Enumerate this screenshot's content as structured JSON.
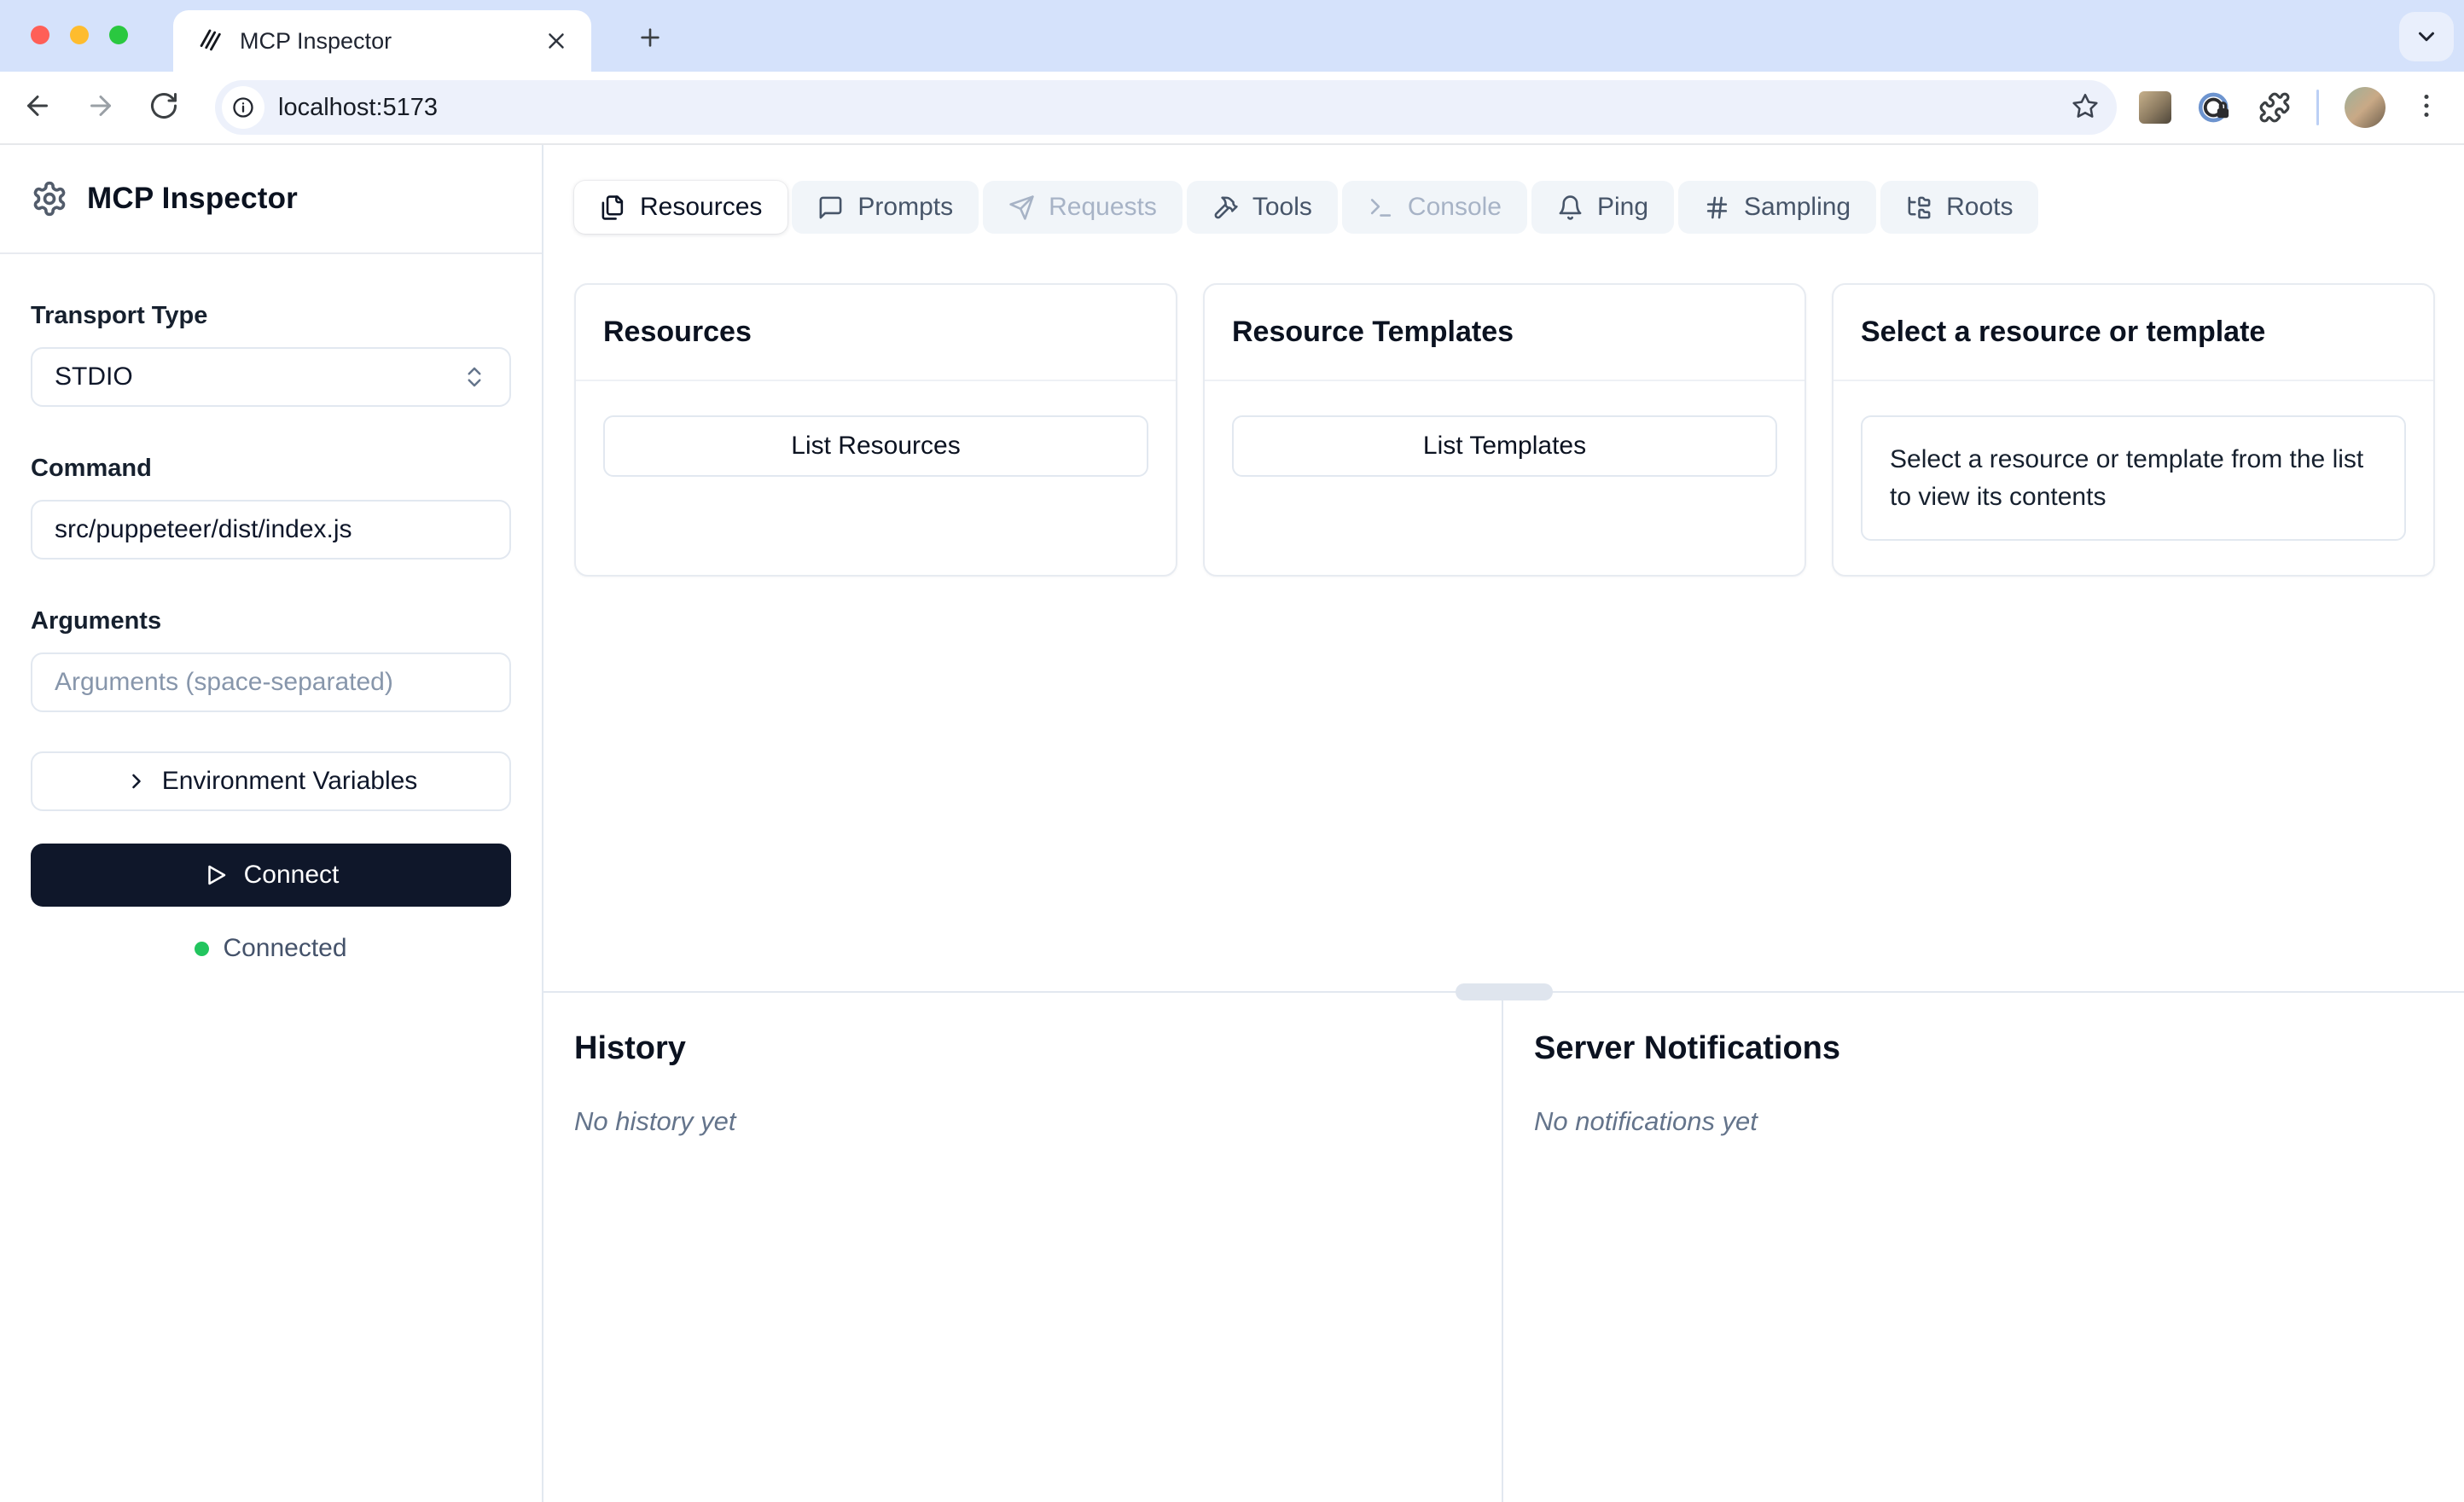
{
  "browser": {
    "tab_title": "MCP Inspector",
    "url": "localhost:5173"
  },
  "sidebar": {
    "title": "MCP Inspector",
    "transport": {
      "label": "Transport Type",
      "value": "STDIO"
    },
    "command": {
      "label": "Command",
      "value": "src/puppeteer/dist/index.js"
    },
    "args": {
      "label": "Arguments",
      "placeholder": "Arguments (space-separated)"
    },
    "env_variables_label": "Environment Variables",
    "connect_label": "Connect",
    "status": {
      "label": "Connected",
      "color": "#22c55e"
    }
  },
  "main": {
    "tabs": [
      {
        "label": "Resources",
        "state": "active"
      },
      {
        "label": "Prompts",
        "state": "enabled"
      },
      {
        "label": "Requests",
        "state": "disabled"
      },
      {
        "label": "Tools",
        "state": "enabled"
      },
      {
        "label": "Console",
        "state": "disabled"
      },
      {
        "label": "Ping",
        "state": "enabled"
      },
      {
        "label": "Sampling",
        "state": "enabled"
      },
      {
        "label": "Roots",
        "state": "enabled"
      }
    ],
    "cards": {
      "resources": {
        "title": "Resources",
        "button": "List Resources"
      },
      "templates": {
        "title": "Resource Templates",
        "button": "List Templates"
      },
      "viewer": {
        "title": "Select a resource or template",
        "body": "Select a resource or template from the list to view its contents"
      }
    }
  },
  "bottom": {
    "history": {
      "title": "History",
      "empty": "No history yet"
    },
    "notifications": {
      "title": "Server Notifications",
      "empty": "No notifications yet"
    }
  },
  "colors": {
    "connected_green": "#22c55e",
    "connect_button": "#0f172a",
    "tabstrip_blue": "#d5e2fb",
    "border": "#e2e8f0"
  }
}
